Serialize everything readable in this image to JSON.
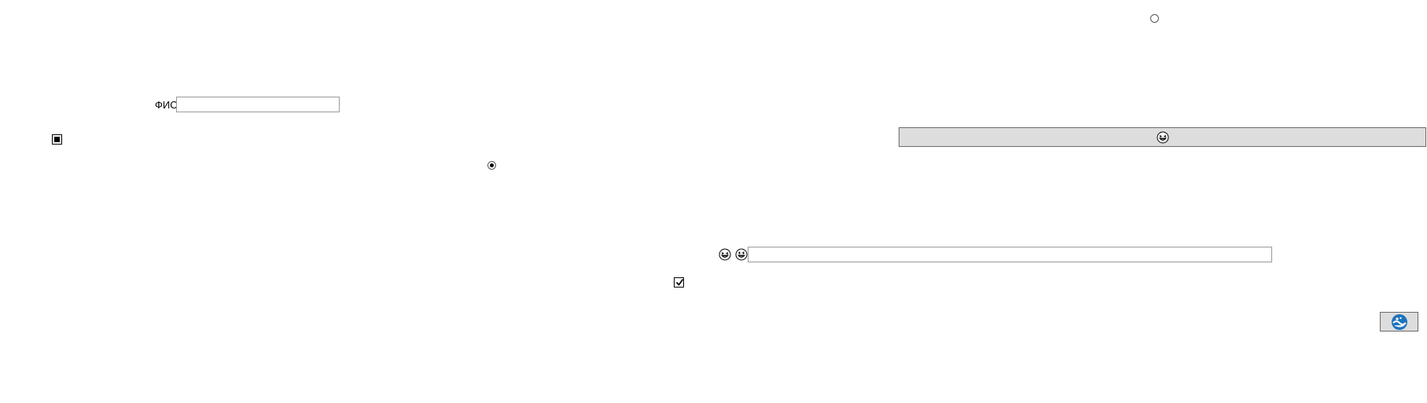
{
  "form": {
    "fio_label": "ФИО",
    "fio_value": "",
    "fio_placeholder": "",
    "long_input_value": "",
    "long_input_placeholder": ""
  },
  "controls": {
    "top_radio_checked": false,
    "middle_radio_checked": true,
    "left_checkbox_state": "indeterminate",
    "bottom_checkbox_checked": true
  },
  "icons": {
    "bar_button_icon": "grinning-squinting-face-icon",
    "long_input_left_icon_1": "grinning-squinting-face-icon",
    "long_input_left_icon_2": "grinning-face-with-big-eyes-icon",
    "corner_button_icon": "blue-wave-globe-icon"
  },
  "colors": {
    "button_bg": "#dddddd",
    "button_border": "#6a6a6a",
    "input_border": "#9a9a9a",
    "icon_blue": "#1e73be"
  }
}
